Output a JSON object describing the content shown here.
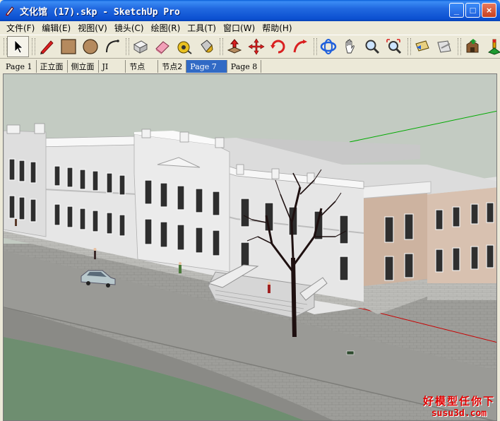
{
  "window": {
    "title": "文化馆 (17).skp - SketchUp Pro",
    "controls": {
      "minimize": "_",
      "maximize": "□",
      "close": "×"
    }
  },
  "menu": [
    {
      "label": "文件(F)"
    },
    {
      "label": "编辑(E)"
    },
    {
      "label": "视图(V)"
    },
    {
      "label": "镜头(C)"
    },
    {
      "label": "绘图(R)"
    },
    {
      "label": "工具(T)"
    },
    {
      "label": "窗口(W)"
    },
    {
      "label": "帮助(H)"
    }
  ],
  "toolbar": {
    "tools": [
      {
        "name": "select-tool",
        "icon": "arrow-icon",
        "active": true
      },
      {
        "name": "line-tool",
        "icon": "pencil-icon"
      },
      {
        "name": "rectangle-tool",
        "icon": "rectangle-icon"
      },
      {
        "name": "circle-tool",
        "icon": "circle-icon"
      },
      {
        "name": "arc-tool",
        "icon": "arc-icon"
      },
      {
        "name": "make-component-tool",
        "icon": "component-icon"
      },
      {
        "name": "eraser-tool",
        "icon": "eraser-icon"
      },
      {
        "name": "tape-measure-tool",
        "icon": "tape-measure-icon"
      },
      {
        "name": "paint-bucket-tool",
        "icon": "paint-bucket-icon"
      },
      {
        "name": "push-pull-tool",
        "icon": "push-pull-icon"
      },
      {
        "name": "move-tool",
        "icon": "move-icon"
      },
      {
        "name": "rotate-tool",
        "icon": "rotate-icon"
      },
      {
        "name": "follow-me-tool",
        "icon": "follow-me-icon"
      },
      {
        "name": "orbit-tool",
        "icon": "orbit-icon"
      },
      {
        "name": "pan-tool",
        "icon": "hand-icon"
      },
      {
        "name": "zoom-tool",
        "icon": "magnifier-icon"
      },
      {
        "name": "zoom-extents-tool",
        "icon": "zoom-extents-icon"
      },
      {
        "name": "previous-view-tool",
        "icon": "previous-view-icon"
      },
      {
        "name": "next-view-tool",
        "icon": "next-view-icon"
      },
      {
        "name": "warehouse-tool",
        "icon": "warehouse-icon"
      },
      {
        "name": "geo-location-tool",
        "icon": "location-pin-icon"
      }
    ]
  },
  "tabs": [
    {
      "label": "Page 1",
      "serif": true
    },
    {
      "label": "正立面"
    },
    {
      "label": "侧立面"
    },
    {
      "label": "JI",
      "serif": true
    },
    {
      "label": "节点"
    },
    {
      "label": "节点2"
    },
    {
      "label": "Page 7",
      "serif": true,
      "active": true
    },
    {
      "label": "Page 8",
      "serif": true
    }
  ],
  "watermark": {
    "title": "好模型任你下",
    "url": "susu3d.com"
  },
  "colors": {
    "titlebar": "#0B4FD0",
    "active_tab": "#316AC5",
    "sky": "#BFC7C0",
    "facade": "#E6E6E6",
    "brick": "#D8C1B0",
    "ground": "#9C9C98",
    "lawn": "#6E8E70",
    "axis_red": "#C80000",
    "axis_green": "#00AA00"
  }
}
